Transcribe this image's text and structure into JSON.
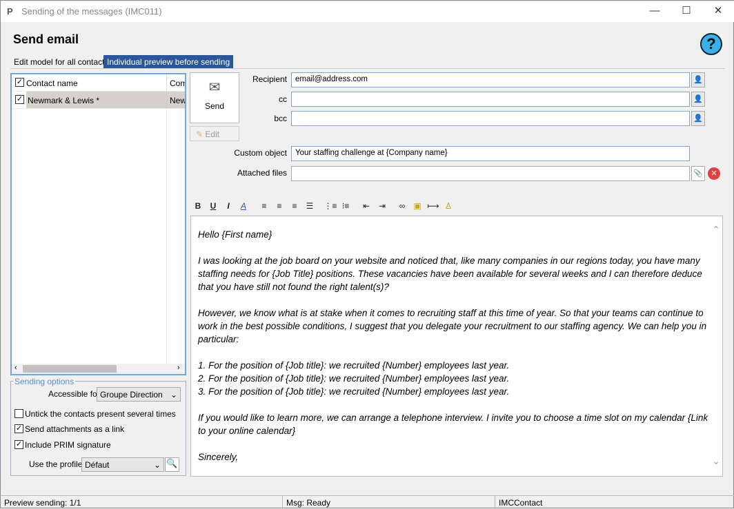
{
  "window": {
    "title": "Sending of the messages (IMC011)",
    "minimize": "—",
    "maximize": "☐",
    "close": "✕"
  },
  "header": {
    "title": "Send email",
    "help": "?"
  },
  "tabs": [
    {
      "label": "Edit model for all contacts"
    },
    {
      "label": "Individual preview before sending",
      "active": true
    }
  ],
  "contacts": {
    "columns": [
      "Contact name",
      "Com"
    ],
    "rows": [
      {
        "name": "Newmark & Lewis *",
        "company": "New",
        "checked": true
      }
    ]
  },
  "actions": {
    "send": "Send",
    "edit": "Edit"
  },
  "fields": {
    "recipient_label": "Recipient",
    "recipient": "email@address.com",
    "cc_label": "cc",
    "cc": "",
    "bcc_label": "bcc",
    "bcc": "",
    "object_label": "Custom object",
    "object": "Your staffing challenge at {Company name}",
    "files_label": "Attached files",
    "files": ""
  },
  "options": {
    "legend": "Sending options",
    "accessible_label": "Accessible for",
    "accessible": "Groupe Direction",
    "untick": "Untick the contacts present several times",
    "untick_checked": false,
    "attach_link": "Send attachments as a link",
    "attach_checked": true,
    "signature": "Include PRIM signature",
    "signature_checked": true,
    "profile_label": "Use the profile",
    "profile": "Défaut"
  },
  "toolbar": {
    "bold": "B",
    "underline": "U",
    "italic": "I",
    "font_color": "A"
  },
  "body": [
    "Hello {First name}",
    "I was looking at the job board on your website and noticed that, like many companies in our regions today, you have many staffing needs for {Job Title} positions. These vacancies have been available for several weeks and I can therefore deduce that you have still not found the right talent(s)?",
    "However, we know what is at stake when it comes to recruiting staff at this time of year. So that your teams can continue to work in the best possible conditions, I suggest that you delegate your recruitment to our staffing agency. We can help you in particular:",
    "1. For the position of {Job title}: we recruited {Number} employees last year.",
    "2. For the position of {Job title}: we recruited {Number} employees last year.",
    "3. For the position of {Job title}: we recruited {Number} employees last year.",
    "If you would like to learn more, we can arrange a telephone interview. I invite you to choose a time slot on my calendar {Link to your online calendar}",
    "Sincerely,"
  ],
  "statusbar": {
    "preview": "Preview sending: 1/1",
    "msg": "Msg: Ready",
    "app": "IMCContact"
  },
  "colors": {
    "accent": "#2b579a",
    "border": "#6fa8dc"
  }
}
